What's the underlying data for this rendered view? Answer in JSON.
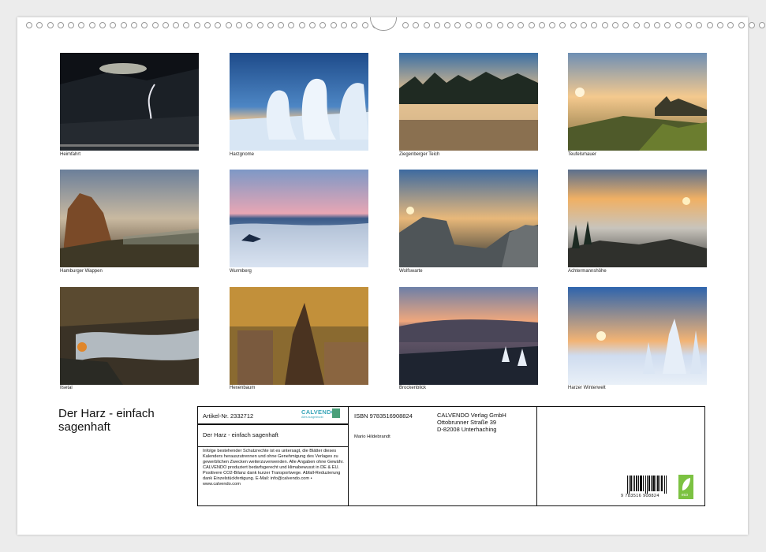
{
  "photos": [
    {
      "caption": "Heimfahrt"
    },
    {
      "caption": "Harzgnome"
    },
    {
      "caption": "Ziegenberger Teich"
    },
    {
      "caption": "Teufelsmauer"
    },
    {
      "caption": "Hamburger Wappen"
    },
    {
      "caption": "Wurmberg"
    },
    {
      "caption": "Wolfswarte"
    },
    {
      "caption": "Achtermannshöhe"
    },
    {
      "caption": "Ilsetal"
    },
    {
      "caption": "Hexenbaum"
    },
    {
      "caption": "Brockenblick"
    },
    {
      "caption": "Harzer Winterwelt"
    }
  ],
  "calendar_title": "Der Harz - einfach sagenhaft",
  "article_no": "Artikel-Nr. 2332712",
  "publisher_logo": "CALVENDO",
  "publisher_logo_sub": "Alles ausgedruckt",
  "subtitle_line": "Der Harz - einfach sagenhaft",
  "legal_text": "Infolge bestehender Schutzrechte ist es untersagt, die Blätter dieses Kalenders herauszutrennen und ohne Genehmigung des Verlages zu gewerblichen Zwecken weiterzuverwenden. Alle Angaben ohne Gewähr. CALVENDO produziert bedarfsgerecht und klimabewusst in DE & EU. Positivere CO2-Bilanz dank kurzer Transportwege. Abfall-Reduzierung dank Einzelstückfertigung. E-Mail: info@calvendo.com • www.calvendo.com",
  "isbn": "ISBN 9783516908824",
  "author": "Mario Hildebrandt",
  "publisher_name": "CALVENDO Verlag GmbH",
  "publisher_street": "Ottobrunner Straße 39",
  "publisher_city": "D-82008 Unterhaching",
  "barcode_digits": "9 783516 908824",
  "eco_label": "eco"
}
